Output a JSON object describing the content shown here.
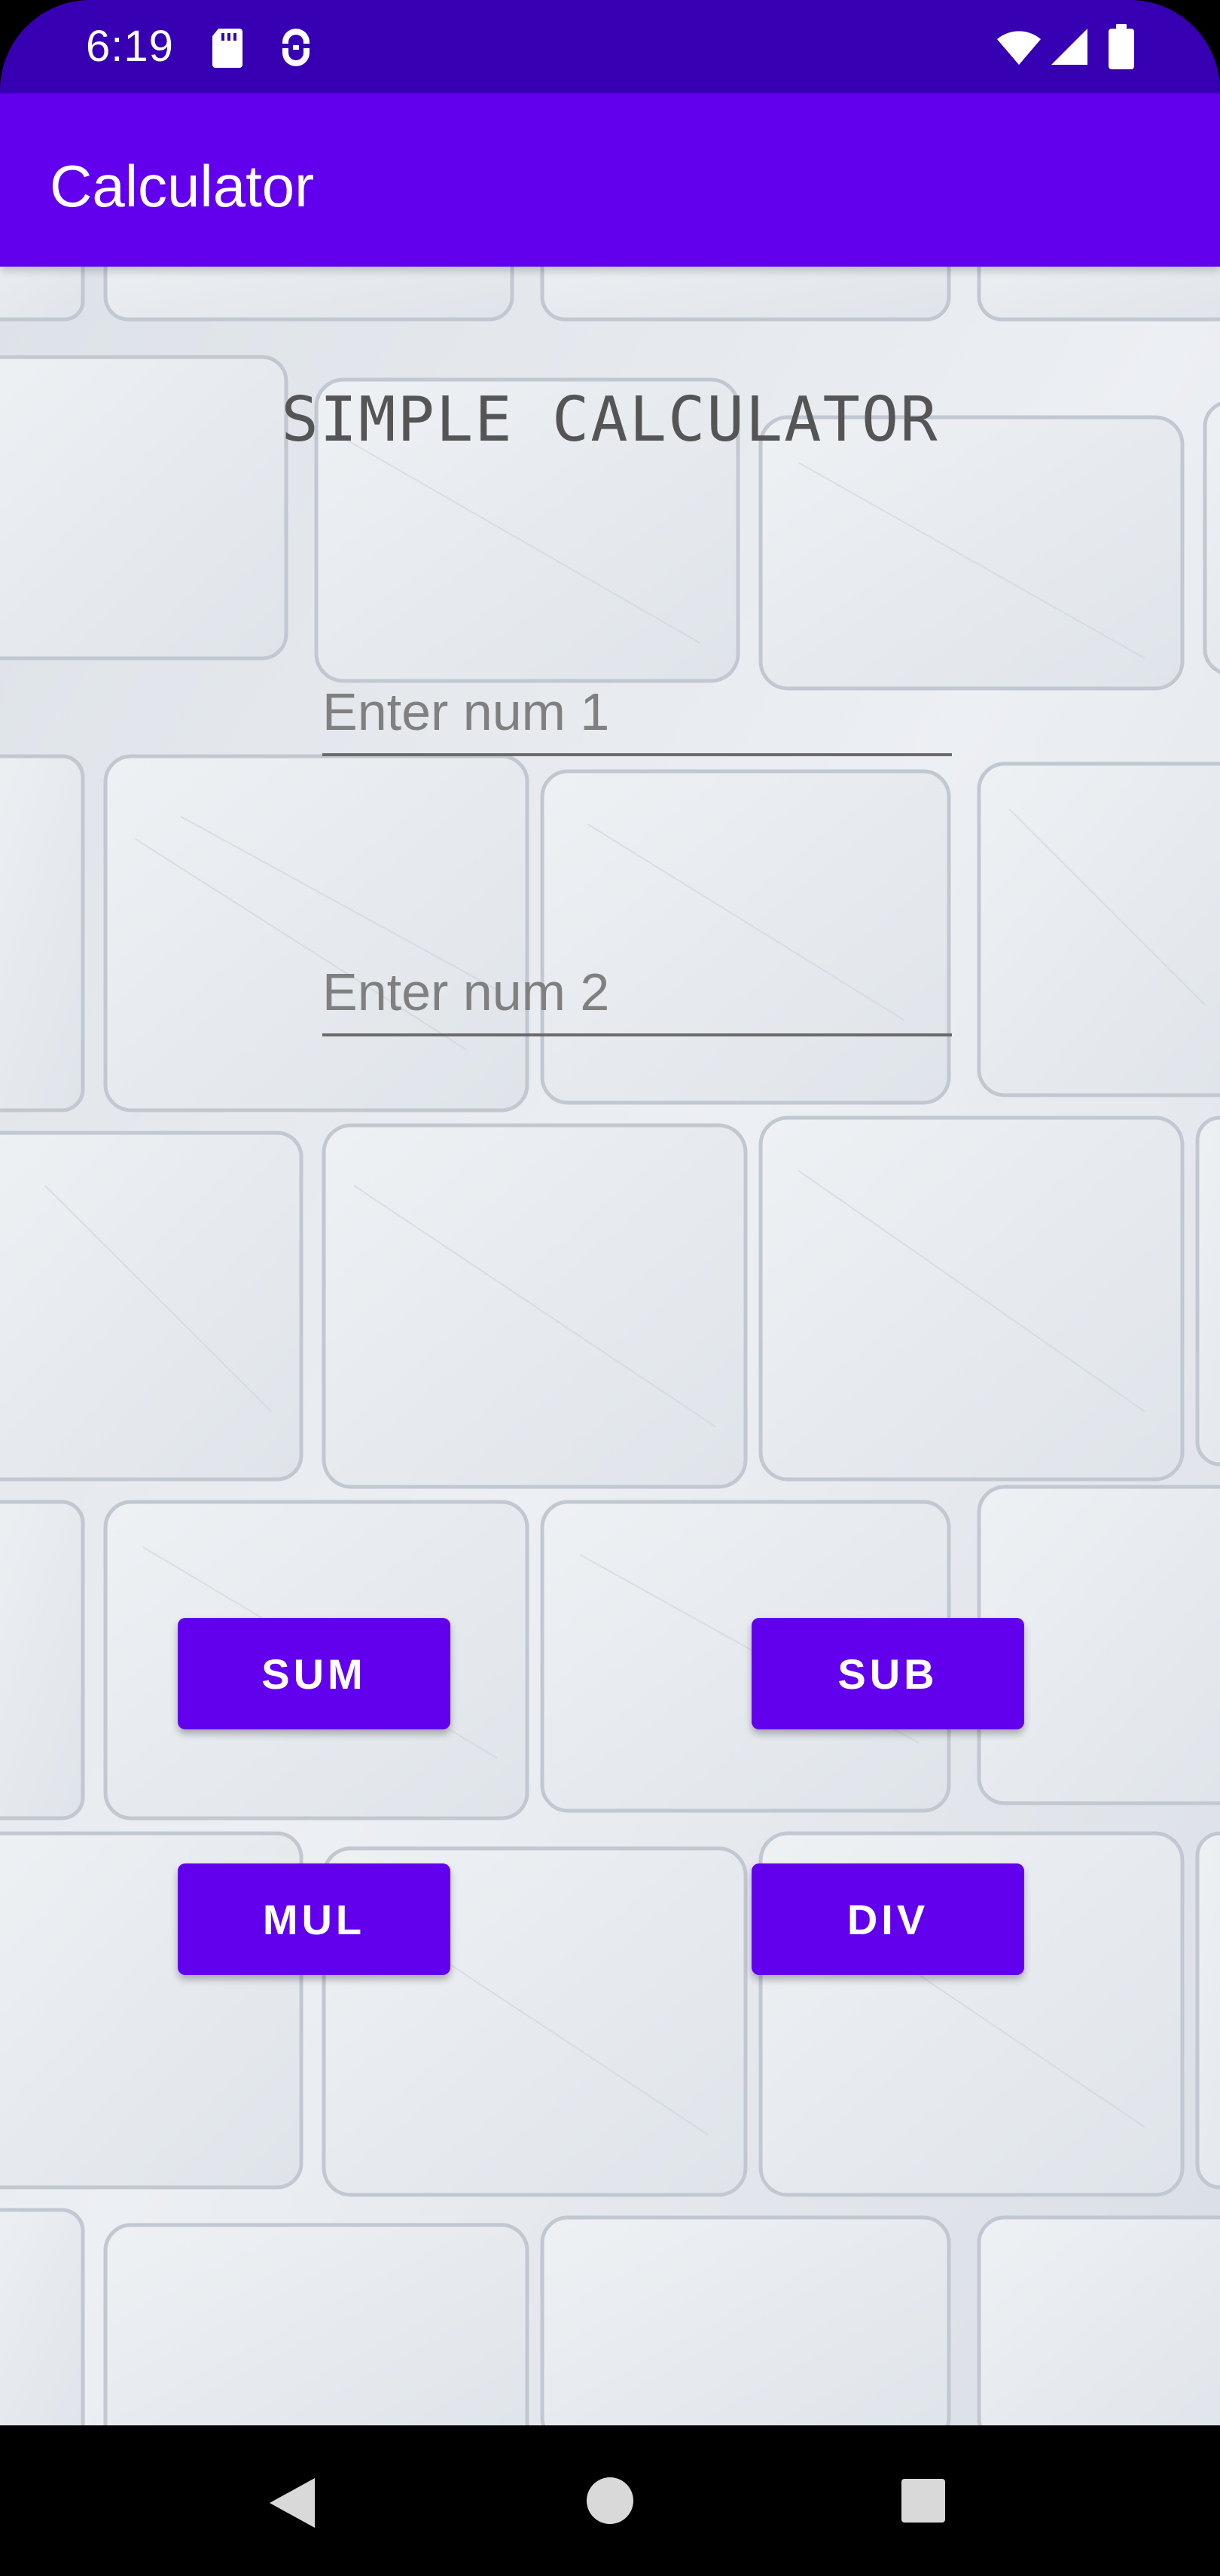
{
  "status_bar": {
    "time": "6:19",
    "icons": [
      "sd-card-icon",
      "cloud-sync-icon",
      "wifi-icon",
      "signal-icon",
      "battery-icon"
    ]
  },
  "app_bar": {
    "title": "Calculator",
    "color": "#6200ee"
  },
  "main": {
    "heading": "SIMPLE CALCULATOR",
    "num1": {
      "value": "",
      "placeholder": "Enter num 1"
    },
    "num2": {
      "value": "",
      "placeholder": "Enter num 2"
    },
    "buttons": {
      "sum": "SUM",
      "sub": "SUB",
      "mul": "MUL",
      "div": "DIV"
    },
    "background": "white-brick-wall"
  },
  "nav_bar": {
    "icons": [
      "back-icon",
      "home-icon",
      "recents-icon"
    ]
  },
  "colors": {
    "status_bar": "#3700b3",
    "primary": "#6200ee",
    "button_text": "#ffffff"
  }
}
